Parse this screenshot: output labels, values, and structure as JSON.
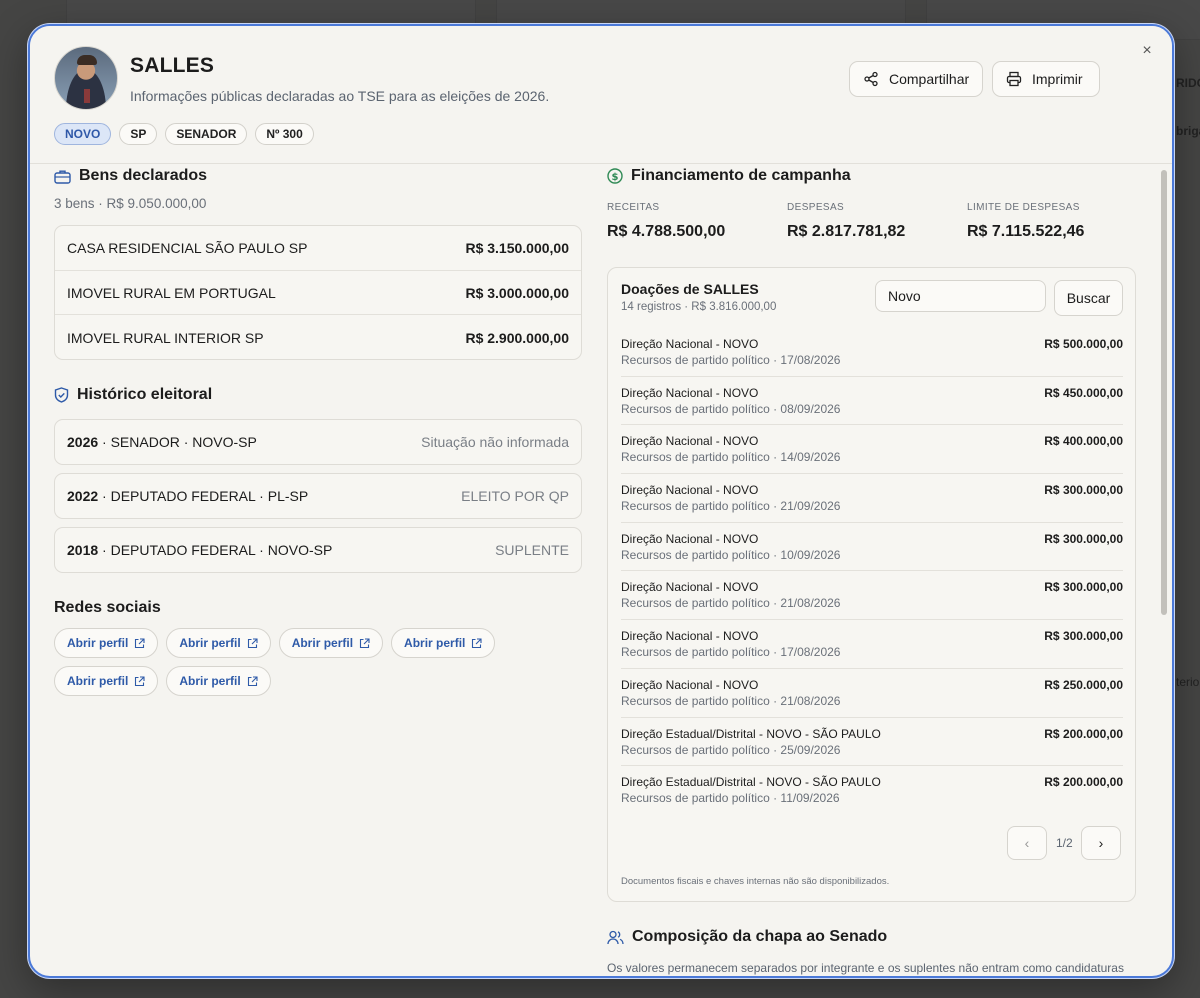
{
  "background": {
    "fragments": [
      "RIDO",
      "briga",
      "terior"
    ]
  },
  "header": {
    "name": "SALLES",
    "subtitle": "Informações públicas declaradas ao TSE para as eleições de 2026.",
    "tags": [
      "NOVO",
      "SP",
      "SENADOR",
      "Nº 300"
    ],
    "share_label": "Compartilhar",
    "print_label": "Imprimir",
    "close_symbol": "×"
  },
  "assets": {
    "title": "Bens declarados",
    "summary": "3 bens · R$ 9.050.000,00",
    "items": [
      {
        "label": "CASA RESIDENCIAL SÃO PAULO SP",
        "value": "R$ 3.150.000,00"
      },
      {
        "label": "IMOVEL RURAL EM PORTUGAL",
        "value": "R$ 3.000.000,00"
      },
      {
        "label": "IMOVEL RURAL INTERIOR SP",
        "value": "R$ 2.900.000,00"
      }
    ]
  },
  "history": {
    "title": "Histórico eleitoral",
    "items": [
      {
        "year": "2026",
        "desc": " · SENADOR · NOVO-SP",
        "status": "Situação não informada"
      },
      {
        "year": "2022",
        "desc": " · DEPUTADO FEDERAL · PL-SP",
        "status": "ELEITO POR QP"
      },
      {
        "year": "2018",
        "desc": " · DEPUTADO FEDERAL · NOVO-SP",
        "status": "SUPLENTE"
      }
    ]
  },
  "social": {
    "title": "Redes sociais",
    "links": [
      "Abrir perfil",
      "Abrir perfil",
      "Abrir perfil",
      "Abrir perfil",
      "Abrir perfil",
      "Abrir perfil"
    ]
  },
  "finance": {
    "title": "Financiamento de campanha",
    "receitas_label": "RECEITAS",
    "receitas": "R$ 4.788.500,00",
    "despesas_label": "DESPESAS",
    "despesas": "R$ 2.817.781,82",
    "limite_label": "LIMITE DE DESPESAS",
    "limite": "R$ 7.115.522,46"
  },
  "donations": {
    "title": "Doações de SALLES",
    "summary": "14 registros · R$ 3.816.000,00",
    "search_value": "Novo",
    "search_button": "Buscar",
    "rows": [
      {
        "name": "Direção Nacional - NOVO",
        "meta": "Recursos de partido político · 17/08/2026",
        "amount": "R$ 500.000,00"
      },
      {
        "name": "Direção Nacional - NOVO",
        "meta": "Recursos de partido político · 08/09/2026",
        "amount": "R$ 450.000,00"
      },
      {
        "name": "Direção Nacional - NOVO",
        "meta": "Recursos de partido político · 14/09/2026",
        "amount": "R$ 400.000,00"
      },
      {
        "name": "Direção Nacional - NOVO",
        "meta": "Recursos de partido político · 21/09/2026",
        "amount": "R$ 300.000,00"
      },
      {
        "name": "Direção Nacional - NOVO",
        "meta": "Recursos de partido político · 10/09/2026",
        "amount": "R$ 300.000,00"
      },
      {
        "name": "Direção Nacional - NOVO",
        "meta": "Recursos de partido político · 21/08/2026",
        "amount": "R$ 300.000,00"
      },
      {
        "name": "Direção Nacional - NOVO",
        "meta": "Recursos de partido político · 17/08/2026",
        "amount": "R$ 300.000,00"
      },
      {
        "name": "Direção Nacional - NOVO",
        "meta": "Recursos de partido político · 21/08/2026",
        "amount": "R$ 250.000,00"
      },
      {
        "name": "Direção Estadual/Distrital - NOVO - SÃO PAULO",
        "meta": "Recursos de partido político · 25/09/2026",
        "amount": "R$ 200.000,00"
      },
      {
        "name": "Direção Estadual/Distrital - NOVO - SÃO PAULO",
        "meta": "Recursos de partido político · 11/09/2026",
        "amount": "R$ 200.000,00"
      }
    ],
    "pager": "1/2",
    "prev_symbol": "‹",
    "next_symbol": "›",
    "footnote": "Documentos fiscais e chaves internas não são disponibilizados."
  },
  "chapa": {
    "title": "Composição da chapa ao Senado",
    "description": "Os valores permanecem separados por integrante e os suplentes não entram como candidaturas"
  },
  "colors": {
    "accent": "#4b79d8",
    "link": "#2e5aa8",
    "money_icon": "#2f8a55"
  }
}
